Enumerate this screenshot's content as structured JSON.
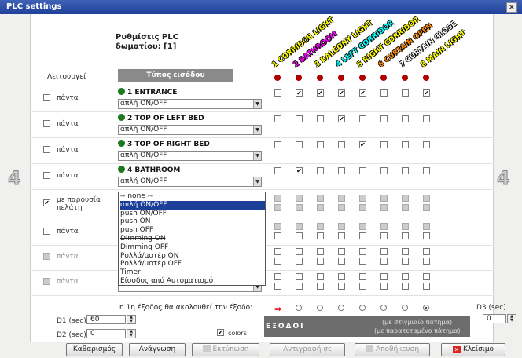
{
  "window": {
    "title": "PLC settings",
    "close": "×"
  },
  "header": {
    "line1": "Ρυθμίσεις PLC",
    "line2": "δωματίου: [1]",
    "func_label": "Λειτουργεί",
    "type_label": "Τύπος εισόδου"
  },
  "outputs": [
    "1 CORRIDOR LIGHT",
    "2 BATHROOM",
    "3 BALCONY LIGHT",
    "4 LEFT CORRIDOR",
    "5 RIGHT CORRIDOR",
    "6 CURTAIN OPEN",
    "7 CURTAIN CLOSE",
    "8 MAIN LIGHT"
  ],
  "rows": [
    {
      "func": "πάντα",
      "name": "1 ENTRANCE",
      "select": "απλή ON/OFF",
      "func_checked": false,
      "checks": [
        false,
        true,
        true,
        true,
        true,
        false,
        false,
        true
      ]
    },
    {
      "func": "πάντα",
      "name": "2 TOP OF LEFT BED",
      "select": "απλή ON/OFF",
      "func_checked": false,
      "checks": [
        false,
        false,
        false,
        true,
        false,
        false,
        false,
        false
      ]
    },
    {
      "func": "πάντα",
      "name": "3 TOP OF RIGHT BED",
      "select": "απλή ON/OFF",
      "func_checked": false,
      "checks": [
        false,
        false,
        false,
        false,
        true,
        false,
        false,
        false
      ]
    },
    {
      "func": "πάντα",
      "name": "4 BATHROOM",
      "select": "απλή ON/OFF",
      "func_checked": false,
      "checks": [
        false,
        true,
        false,
        false,
        false,
        false,
        false,
        false
      ]
    },
    {
      "func": "με παρουσία πελάτη",
      "name": "",
      "select": "",
      "func_checked": true,
      "checks": [
        false,
        false,
        false,
        false,
        false,
        false,
        false,
        false
      ]
    },
    {
      "func": "πάντα",
      "name": "",
      "select": "",
      "func_checked": false,
      "checks": [
        false,
        false,
        false,
        false,
        false,
        false,
        false,
        false
      ]
    },
    {
      "func": "πάντα",
      "name": "",
      "select": "",
      "func_checked": false,
      "checks": [
        false,
        false,
        false,
        false,
        false,
        false,
        false,
        false
      ]
    },
    {
      "func": "πάντα",
      "name": "",
      "select": "",
      "func_checked": false,
      "checks": [
        false,
        false,
        false,
        false,
        false,
        false,
        false,
        false
      ]
    }
  ],
  "dropdown": [
    "-- none --",
    "απλή ON/OFF",
    "push ON/OFF",
    "push ON",
    "push OFF",
    "Dimming ON",
    "Dimming OFF",
    "Ρολλά/μοτέρ ON",
    "Ρολλά/μοτέρ OFF",
    "Timer",
    "Είσοδος από Αυτοματισμό"
  ],
  "page_marker": "4",
  "follow_text": "η 1η έξοδος θα ακολουθεί την έξοδο:",
  "radio_selected": 7,
  "d1": {
    "label": "D1 (sec)",
    "value": "60"
  },
  "d2": {
    "label": "D2 (sec)",
    "value": "0"
  },
  "d3": {
    "label": "D3 (sec)",
    "value": "0"
  },
  "colors_label": "colors",
  "outbar": {
    "title": "ΕΞΟΔΟΙ",
    "note1": "(με στιγμιαίο πάτημα)",
    "note2": "(με παρατεταμένο πάτημα)"
  },
  "buttons": {
    "clear": "Καθαρισμός",
    "read": "Ανάγνωση",
    "print": "Εκτύπωση",
    "copy": "Αντιγραφή σε",
    "save": "Αποθήκευση",
    "close": "Κλείσιμο"
  }
}
